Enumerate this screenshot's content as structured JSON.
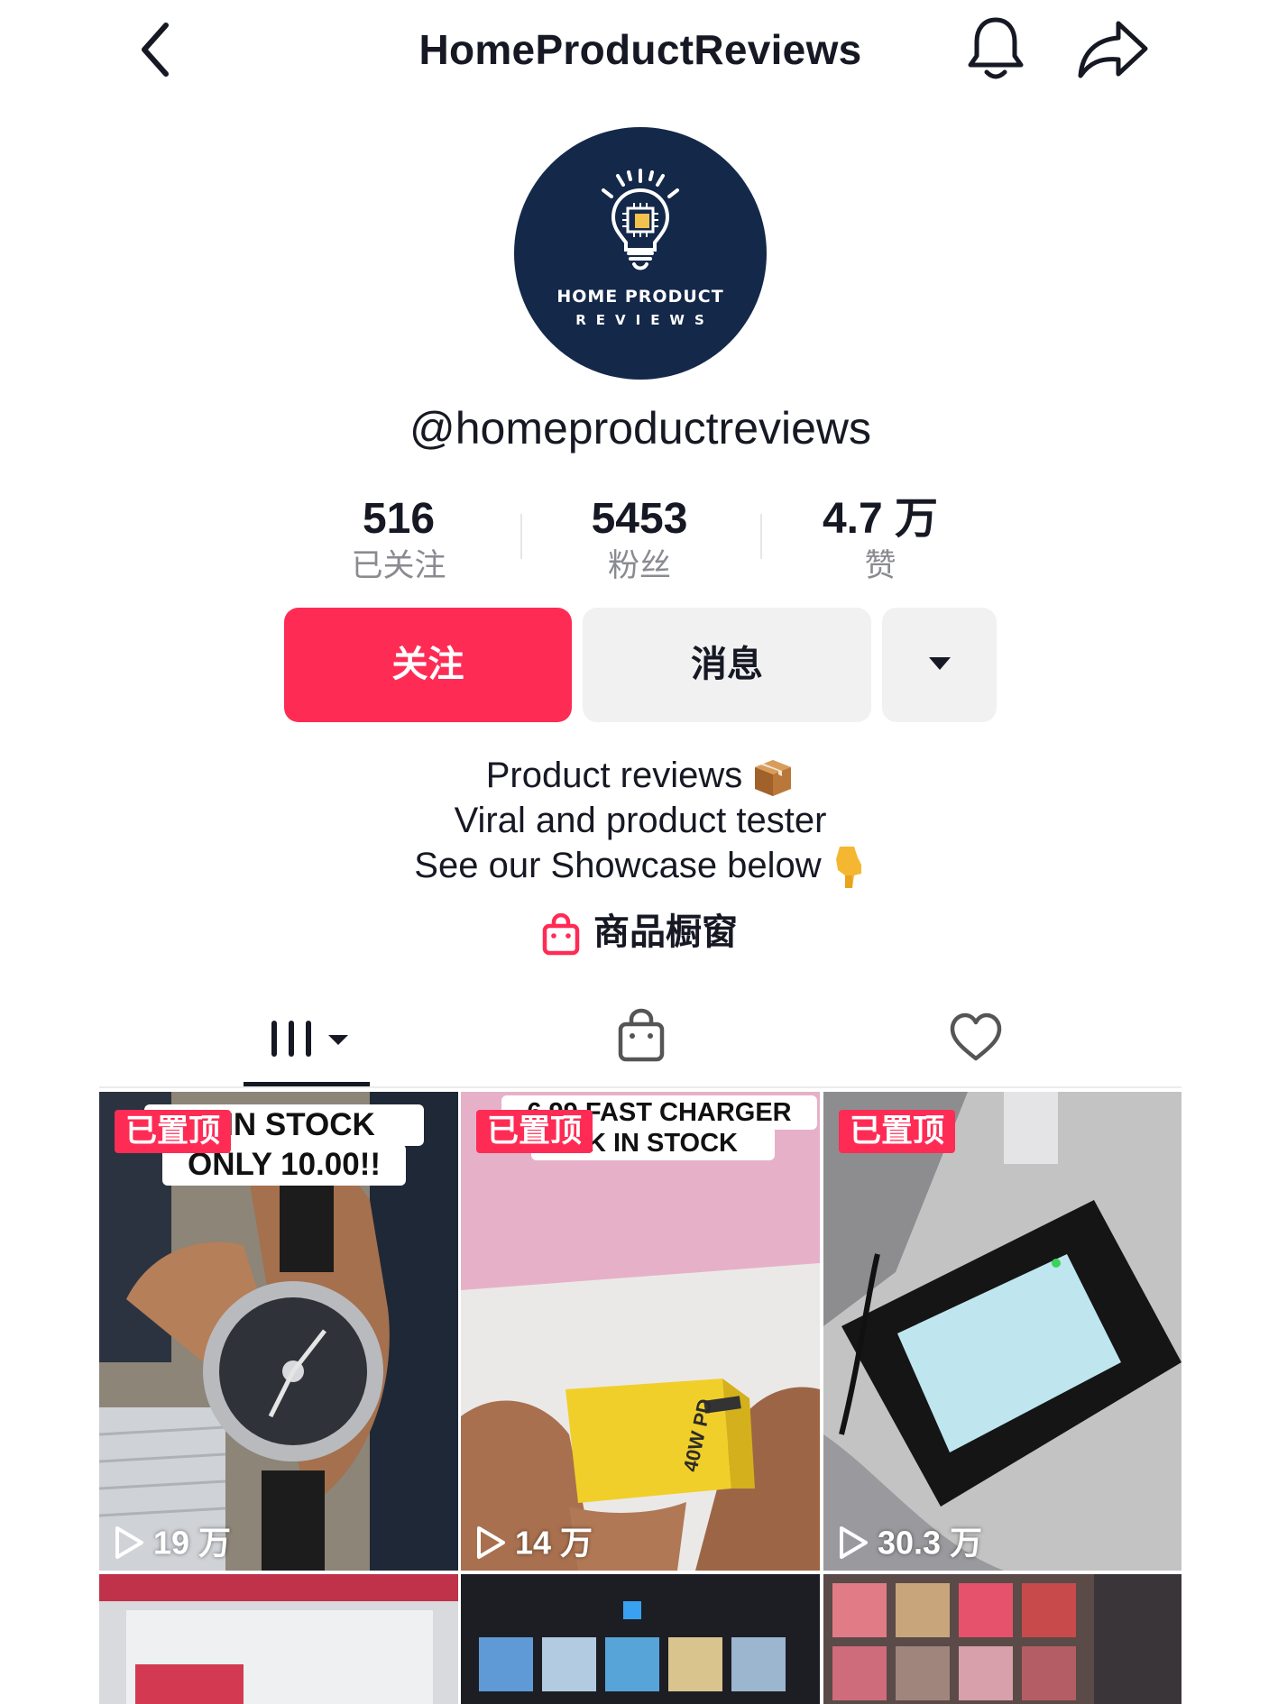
{
  "header": {
    "title": "HomeProductReviews",
    "back_icon": "chevron-left-icon",
    "bell_icon": "bell-icon",
    "share_icon": "share-icon"
  },
  "profile": {
    "avatar_logo_line1": "HOME PRODUCT",
    "avatar_logo_line2": "REVIEWS",
    "handle": "@homeproductreviews"
  },
  "stats": [
    {
      "value": "516",
      "label": "已关注"
    },
    {
      "value": "5453",
      "label": "粉丝"
    },
    {
      "value": "4.7 万",
      "label": "赞"
    }
  ],
  "actions": {
    "follow": "关注",
    "message": "消息",
    "more_icon": "caret-down-icon"
  },
  "bio": {
    "line1": "Product reviews",
    "line2": "Viral and product tester",
    "line3": "See our Showcase below"
  },
  "showcase": {
    "label": "商品橱窗",
    "icon": "shopping-bag-icon"
  },
  "tabs": [
    {
      "name": "videos",
      "icon": "grid-icon",
      "active": true
    },
    {
      "name": "shop",
      "icon": "shopping-bag-icon",
      "active": false
    },
    {
      "name": "liked",
      "icon": "heart-icon",
      "active": false
    }
  ],
  "videos": [
    {
      "pinned": "已置顶",
      "caption_line1": "K IN STOCK",
      "caption_line2": "ONLY 10.00!!",
      "views": "19 万"
    },
    {
      "pinned": "已置顶",
      "caption_line1": "6.99 FAST CHARGER",
      "caption_line2": "CK IN STOCK",
      "charger_label": "40W PD",
      "views": "14 万"
    },
    {
      "pinned": "已置顶",
      "views": "30.3 万"
    }
  ],
  "colors": {
    "accent": "#fe2c55",
    "avatar_bg": "#14284a",
    "text": "#161823",
    "muted": "#8a8b91",
    "button_gray": "#f1f1f2"
  }
}
